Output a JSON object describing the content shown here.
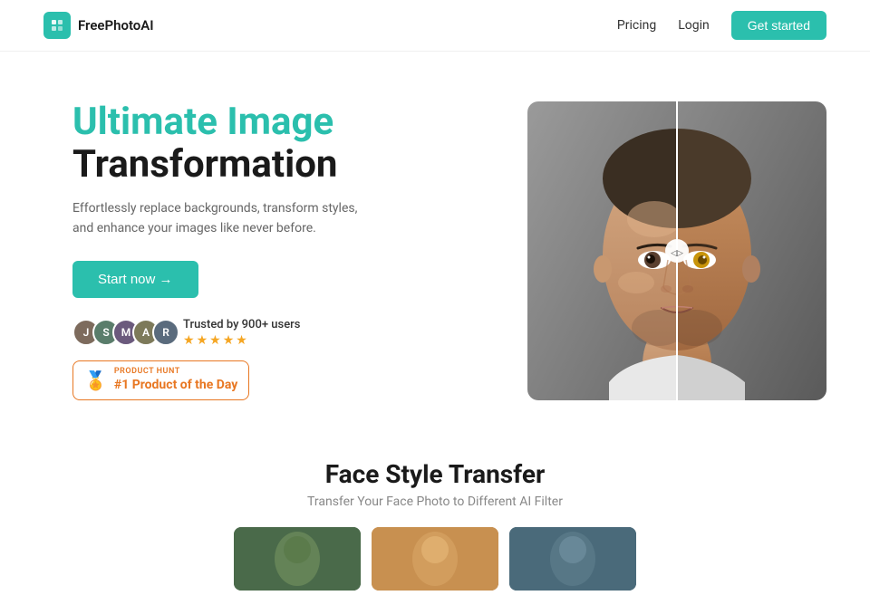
{
  "nav": {
    "logo_text": "FreePhotoAI",
    "pricing_label": "Pricing",
    "login_label": "Login",
    "get_started_label": "Get started"
  },
  "hero": {
    "title_accent": "Ultimate Image",
    "title_dark": "Transformation",
    "subtitle": "Effortlessly replace backgrounds, transform styles, and enhance your images like never before.",
    "cta_label": "Start now →",
    "trust_text": "Trusted by 900+ users",
    "stars": [
      "★",
      "★",
      "★",
      "★",
      "★"
    ],
    "product_hunt_small": "PRODUCT HUNT",
    "product_hunt_big": "#1 Product of the Day"
  },
  "bottom": {
    "section_title": "Face Style Transfer",
    "section_subtitle": "Transfer Your Face Photo to Different AI Filter"
  }
}
